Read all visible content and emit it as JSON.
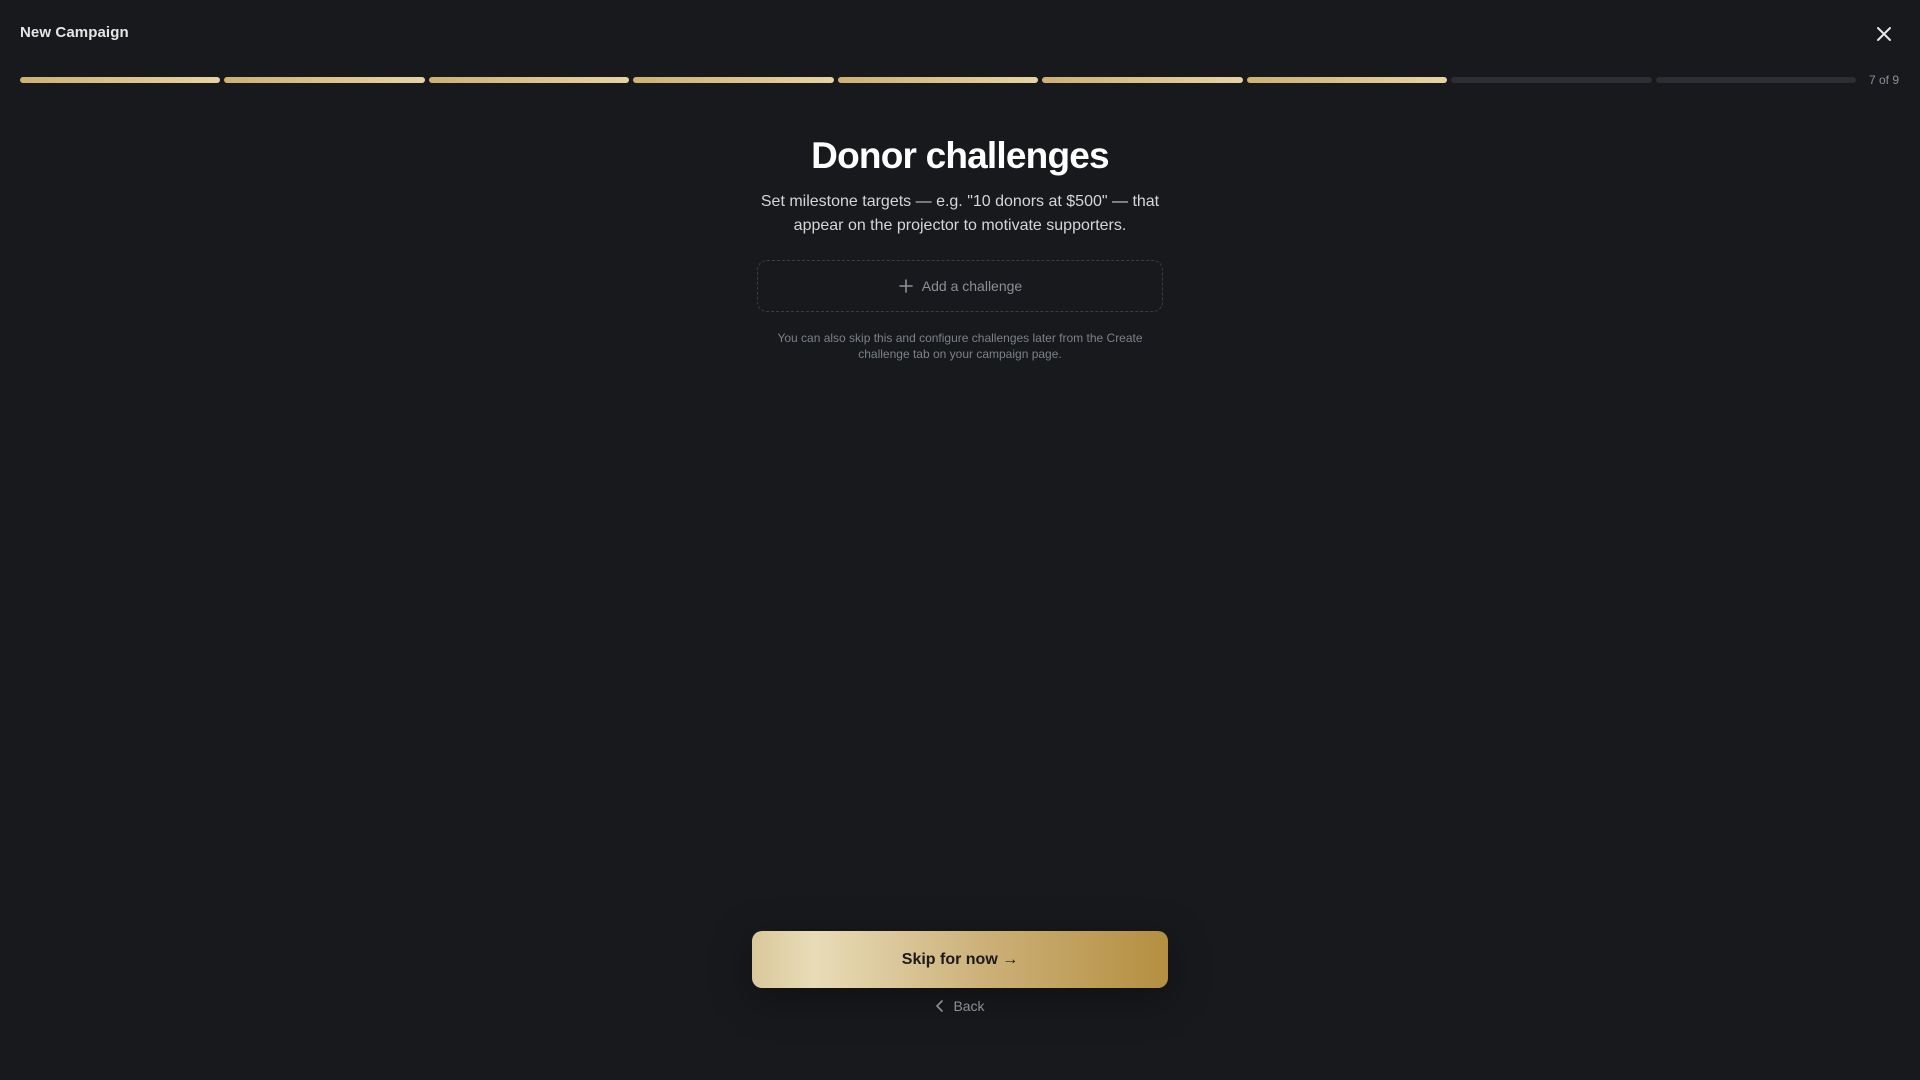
{
  "header": {
    "title": "New Campaign",
    "close_icon": "close-icon"
  },
  "progress": {
    "total_steps": 9,
    "current_step": 7,
    "counter_label": "7 of 9",
    "active_color": "#d9c48f",
    "inactive_color": "#2c2e33"
  },
  "main": {
    "heading": "Donor challenges",
    "description": "Set milestone targets — e.g. \"10 donors at $500\" — that appear on the projector to motivate supporters.",
    "add_button": {
      "icon": "plus-icon",
      "label": "Add a challenge"
    },
    "hint": "You can also skip this and configure challenges later from the Create challenge tab on your campaign page."
  },
  "footer": {
    "primary_label": "Skip for now →",
    "back_icon": "chevron-left-icon",
    "back_label": "Back"
  }
}
